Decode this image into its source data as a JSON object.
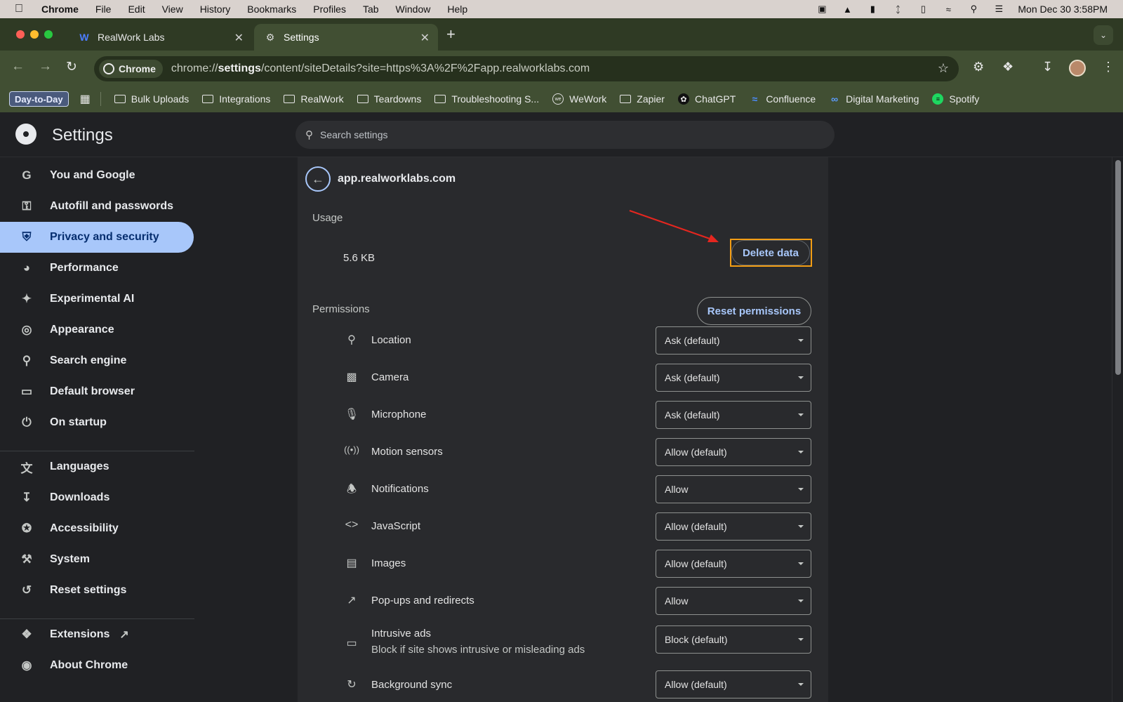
{
  "menubar": {
    "app": "Chrome",
    "items": [
      "File",
      "Edit",
      "View",
      "History",
      "Bookmarks",
      "Profiles",
      "Tab",
      "Window",
      "Help"
    ],
    "datetime": "Mon Dec 30  3:58PM"
  },
  "tabs": [
    {
      "title": "RealWork Labs",
      "icon": "realwork-logo-icon"
    },
    {
      "title": "Settings",
      "icon": "gear-icon"
    }
  ],
  "toolbar": {
    "chip_label": "Chrome",
    "url_host": "chrome://",
    "url_bold": "settings",
    "url_rest": "/content/siteDetails?site=https%3A%2F%2Fapp.realworklabs.com"
  },
  "bookmarks": {
    "group_label": "Day-to-Day",
    "items": [
      {
        "label": "Bulk Uploads",
        "icon": "folder-icon"
      },
      {
        "label": "Integrations",
        "icon": "folder-icon"
      },
      {
        "label": "RealWork",
        "icon": "folder-icon"
      },
      {
        "label": "Teardowns",
        "icon": "folder-icon"
      },
      {
        "label": "Troubleshooting S...",
        "icon": "folder-icon"
      },
      {
        "label": "WeWork",
        "icon": "wework-icon"
      },
      {
        "label": "Zapier",
        "icon": "folder-icon"
      },
      {
        "label": "ChatGPT",
        "icon": "chatgpt-icon"
      },
      {
        "label": "Confluence",
        "icon": "confluence-icon"
      },
      {
        "label": "Digital Marketing",
        "icon": "meta-icon"
      },
      {
        "label": "Spotify",
        "icon": "spotify-icon"
      }
    ]
  },
  "settings": {
    "title": "Settings",
    "search_placeholder": "Search settings"
  },
  "sidebar": {
    "items": [
      {
        "label": "You and Google",
        "icon": "google-icon"
      },
      {
        "label": "Autofill and passwords",
        "icon": "key-icon"
      },
      {
        "label": "Privacy and security",
        "icon": "shield-icon",
        "active": true
      },
      {
        "label": "Performance",
        "icon": "speedometer-icon"
      },
      {
        "label": "Experimental AI",
        "icon": "sparkle-icon"
      },
      {
        "label": "Appearance",
        "icon": "palette-icon"
      },
      {
        "label": "Search engine",
        "icon": "search-icon"
      },
      {
        "label": "Default browser",
        "icon": "browser-icon"
      },
      {
        "label": "On startup",
        "icon": "power-icon"
      },
      {
        "label": "Languages",
        "icon": "translate-icon"
      },
      {
        "label": "Downloads",
        "icon": "download-icon"
      },
      {
        "label": "Accessibility",
        "icon": "accessibility-icon"
      },
      {
        "label": "System",
        "icon": "wrench-icon"
      },
      {
        "label": "Reset settings",
        "icon": "reset-icon"
      },
      {
        "label": "Extensions",
        "icon": "puzzle-icon"
      },
      {
        "label": "About Chrome",
        "icon": "chrome-icon"
      }
    ]
  },
  "site": {
    "domain": "app.realworklabs.com",
    "usage_label": "Usage",
    "usage_value": "5.6 KB",
    "delete_label": "Delete data",
    "permissions_label": "Permissions",
    "reset_label": "Reset permissions",
    "permissions": [
      {
        "label": "Location",
        "value": "Ask (default)",
        "icon": "location-pin-icon"
      },
      {
        "label": "Camera",
        "value": "Ask (default)",
        "icon": "camera-icon"
      },
      {
        "label": "Microphone",
        "value": "Ask (default)",
        "icon": "microphone-icon"
      },
      {
        "label": "Motion sensors",
        "value": "Allow (default)",
        "icon": "sensors-icon"
      },
      {
        "label": "Notifications",
        "value": "Allow",
        "icon": "bell-icon"
      },
      {
        "label": "JavaScript",
        "value": "Allow (default)",
        "icon": "code-icon"
      },
      {
        "label": "Images",
        "value": "Allow (default)",
        "icon": "image-icon"
      },
      {
        "label": "Pop-ups and redirects",
        "value": "Allow",
        "icon": "external-link-icon"
      },
      {
        "label": "Intrusive ads",
        "sub": "Block if site shows intrusive or misleading ads",
        "value": "Block (default)",
        "icon": "ads-icon"
      },
      {
        "label": "Background sync",
        "value": "Allow (default)",
        "icon": "sync-icon"
      }
    ]
  },
  "colors": {
    "accent": "#a8c7fa",
    "highlight": "#f29d14",
    "arrow": "#e5261f",
    "tabstrip": "#2f3a24",
    "toolbar": "#414f33"
  }
}
